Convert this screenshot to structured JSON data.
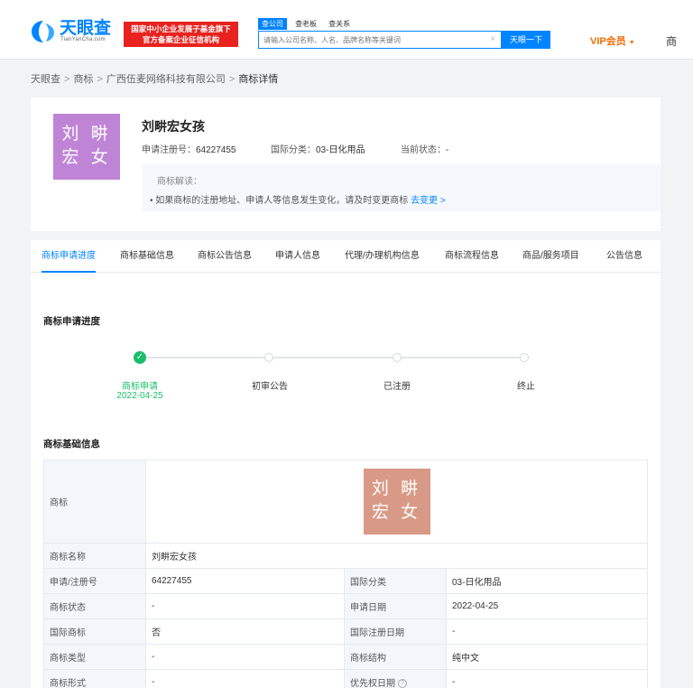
{
  "header": {
    "logo_text": "天眼查",
    "logo_sub": "TianYanCha.com",
    "banner_line1": "国家中小企业发展子基金旗下",
    "banner_line2": "官方备案企业征信机构",
    "search_tabs": [
      "查公司",
      "查老板",
      "查关系"
    ],
    "search_placeholder": "请输入公司名称、人名、品牌名称等关键词",
    "search_clear": "×",
    "search_button": "天眼一下",
    "vip_label": "VIP会员",
    "vip_caret": "▼",
    "more_char": "商"
  },
  "breadcrumb": {
    "items": [
      "天眼查",
      "商标",
      "广西伍麦网络科技有限公司",
      "商标详情"
    ],
    "separator": ">"
  },
  "trademark": {
    "logo_line1": "刘 畊",
    "logo_line2": "宏 女",
    "name": "刘畊宏女孩",
    "reg_no_label": "申请注册号：",
    "reg_no": "64227455",
    "class_label": "国际分类：",
    "class_value": "03-日化用品",
    "status_label": "当前状态：",
    "status_value": "-",
    "info_title": "商标解读：",
    "info_text": "• 如果商标的注册地址、申请人等信息发生变化，请及时变更商标",
    "info_link": "去变更 >"
  },
  "tabs": [
    "商标申请进度",
    "商标基础信息",
    "商标公告信息",
    "申请人信息",
    "代理/办理机构信息",
    "商标流程信息",
    "商品/服务项目",
    "公告信息"
  ],
  "progress": {
    "title": "商标申请进度",
    "steps": [
      {
        "label": "商标申请",
        "date": "2022-04-25",
        "done": true
      },
      {
        "label": "初审公告",
        "date": "",
        "done": false
      },
      {
        "label": "已注册",
        "date": "",
        "done": false
      },
      {
        "label": "终止",
        "date": "",
        "done": false
      }
    ],
    "check_mark": "✓"
  },
  "basic_info": {
    "title": "商标基础信息",
    "trademark_label": "商标",
    "rows": [
      {
        "k1": "商标名称",
        "v1": "刘畊宏女孩"
      },
      {
        "k1": "申请/注册号",
        "v1": "64227455",
        "k2": "国际分类",
        "v2": "03-日化用品"
      },
      {
        "k1": "商标状态",
        "v1": "-",
        "k2": "申请日期",
        "v2": "2022-04-25"
      },
      {
        "k1": "国际商标",
        "v1": "否",
        "k2": "国际注册日期",
        "v2": "-"
      },
      {
        "k1": "商标类型",
        "v1": "-",
        "k2": "商标结构",
        "v2": "纯中文"
      },
      {
        "k1": "商标形式",
        "v1": "-",
        "k2": "优先权日期",
        "v2": "-",
        "help": "?"
      }
    ]
  },
  "colors": {
    "brand": "#0084ff",
    "banner": "#e8221f",
    "vip": "#f16b00",
    "done": "#19be6b",
    "logo_bg": "#c084d6",
    "table_logo_bg": "#d89a86"
  }
}
